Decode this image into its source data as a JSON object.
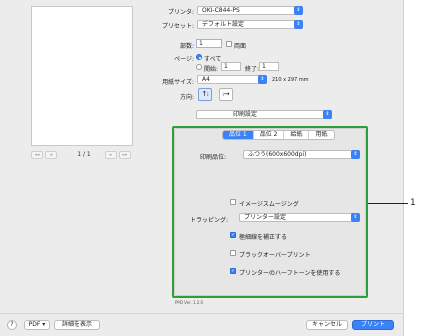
{
  "pager": {
    "prev": "◀◀ ◀",
    "page": "1 / 1",
    "next": "▶ ▶▶"
  },
  "printer": {
    "label": "プリンタ:",
    "value": "OKI-C844-PS"
  },
  "preset": {
    "label": "プリセット:",
    "value": "デフォルト設定"
  },
  "copies": {
    "label": "部数:",
    "value": "1",
    "duplex_label": "両面"
  },
  "pages": {
    "label": "ページ:",
    "all_label": "すべて",
    "from_label": "開始:",
    "from_value": "1",
    "to_label": "終了:",
    "to_value": "1"
  },
  "paper_size": {
    "label": "用紙サイズ:",
    "value": "A4",
    "dimensions": "210 x 297 mm"
  },
  "orientation": {
    "label": "方向:",
    "portrait_glyph": "↑ᵢ",
    "landscape_glyph": "ᵢ→"
  },
  "section_popup": {
    "value": "印刷設定"
  },
  "tabs": [
    {
      "label": "品位 1",
      "active": true
    },
    {
      "label": "品位 2",
      "active": false
    },
    {
      "label": "給紙",
      "active": false
    },
    {
      "label": "用紙",
      "active": false
    }
  ],
  "quality": {
    "label": "印刷品位:",
    "value": "ふつう(600x600dpi)"
  },
  "image_smoothing": {
    "label": "イメージスムージング",
    "checked": false
  },
  "trapping": {
    "label": "トラッピング:",
    "value": "プリンター設定"
  },
  "fine_line": {
    "label": "極細線を補正する",
    "checked": true
  },
  "black_overprint": {
    "label": "ブラックオーバープリント",
    "checked": false
  },
  "halftone": {
    "label": "プリンターのハーフトーンを使用する",
    "checked": true
  },
  "ppd_version": "PPD Ver. 1.2.0",
  "footer": {
    "help": "?",
    "pdf": "PDF",
    "details": "詳細を表示",
    "cancel": "キャンセル",
    "print": "プリント"
  },
  "callout": "1",
  "colors": {
    "accent": "#3b82f6",
    "highlight": "#2e9e3a"
  }
}
